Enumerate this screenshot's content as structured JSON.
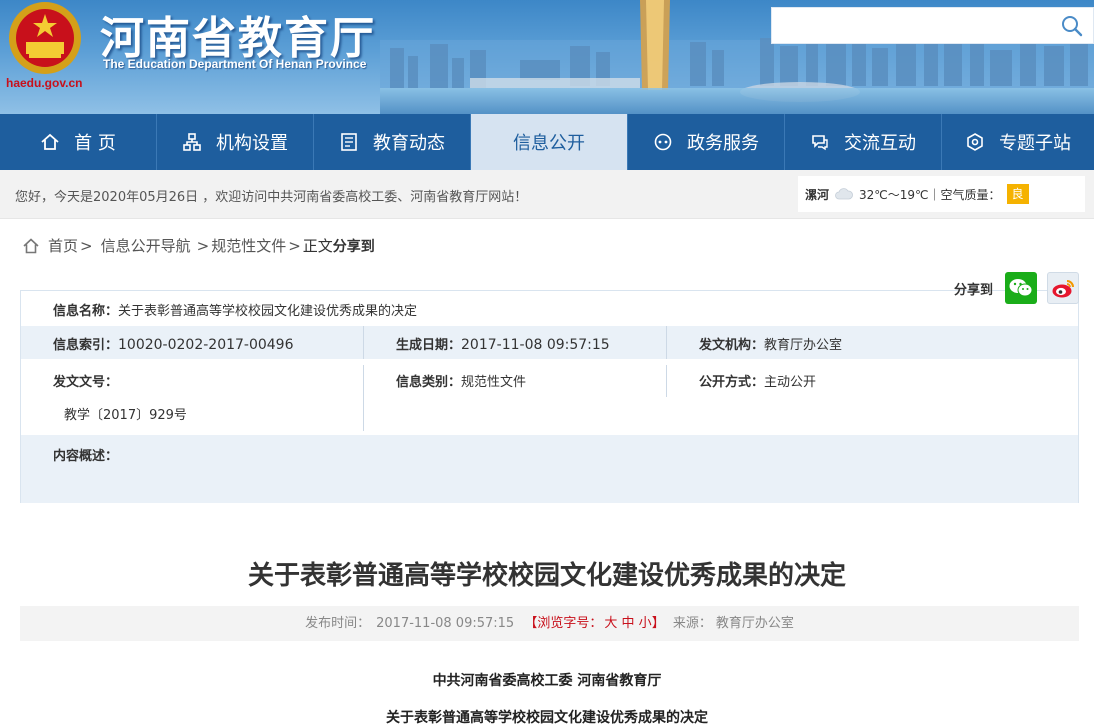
{
  "header": {
    "site_title": "河南省教育厅",
    "site_subtitle": "The Education Department Of Henan Province",
    "domain": "haedu.gov.cn",
    "search_placeholder": ""
  },
  "nav": {
    "items": [
      {
        "label": "首 页",
        "icon": "home-icon"
      },
      {
        "label": "机构设置",
        "icon": "org-icon"
      },
      {
        "label": "教育动态",
        "icon": "news-icon"
      },
      {
        "label": "信息公开",
        "icon": ""
      },
      {
        "label": "政务服务",
        "icon": "service-icon"
      },
      {
        "label": "交流互动",
        "icon": "interact-icon"
      },
      {
        "label": "专题子站",
        "icon": "topic-icon"
      }
    ],
    "active_index": 3
  },
  "infobar": {
    "greeting": "您好，今天是2020年05月26日 ，欢迎访问中共河南省委高校工委、河南省教育厅网站！",
    "weather_city": "漯河",
    "weather_temp": "32℃～19℃｜空气质量：",
    "aqi": "良"
  },
  "breadcrumb": {
    "home": "首页",
    "nav": "信息公开导航",
    "section": "规范性文件",
    "current": "正文",
    "share_label": "分享到"
  },
  "share": {
    "label": "分享到"
  },
  "info": {
    "name_label": "信息名称：",
    "name_value": "关于表彰普通高等学校校园文化建设优秀成果的决定",
    "index_label": "信息索引：",
    "index_value": "10020-0202-2017-00496",
    "date_label": "生成日期：",
    "date_value": "2017-11-08 09:57:15",
    "org_label": "发文机构：",
    "org_value": "教育厅办公室",
    "docno_label": "发文文号：",
    "docno_value": "教学〔2017〕929号",
    "category_label": "信息类别：",
    "category_value": "规范性文件",
    "mode_label": "公开方式：",
    "mode_value": "主动公开",
    "summary_label": "内容概述："
  },
  "article": {
    "title": "关于表彰普通高等学校校园文化建设优秀成果的决定",
    "meta_date_label": "发布时间：",
    "meta_date": "2017-11-08 09:57:15",
    "meta_font": "【浏览字号：",
    "size_large": "大",
    "size_mid": "中",
    "size_small": "小",
    "meta_font_end": "】",
    "meta_source_label": "来源：",
    "meta_source": "教育厅办公室",
    "issuer": "中共河南省委高校工委 河南省教育厅",
    "doc_title": "关于表彰普通高等学校校园文化建设优秀成果的决定"
  }
}
